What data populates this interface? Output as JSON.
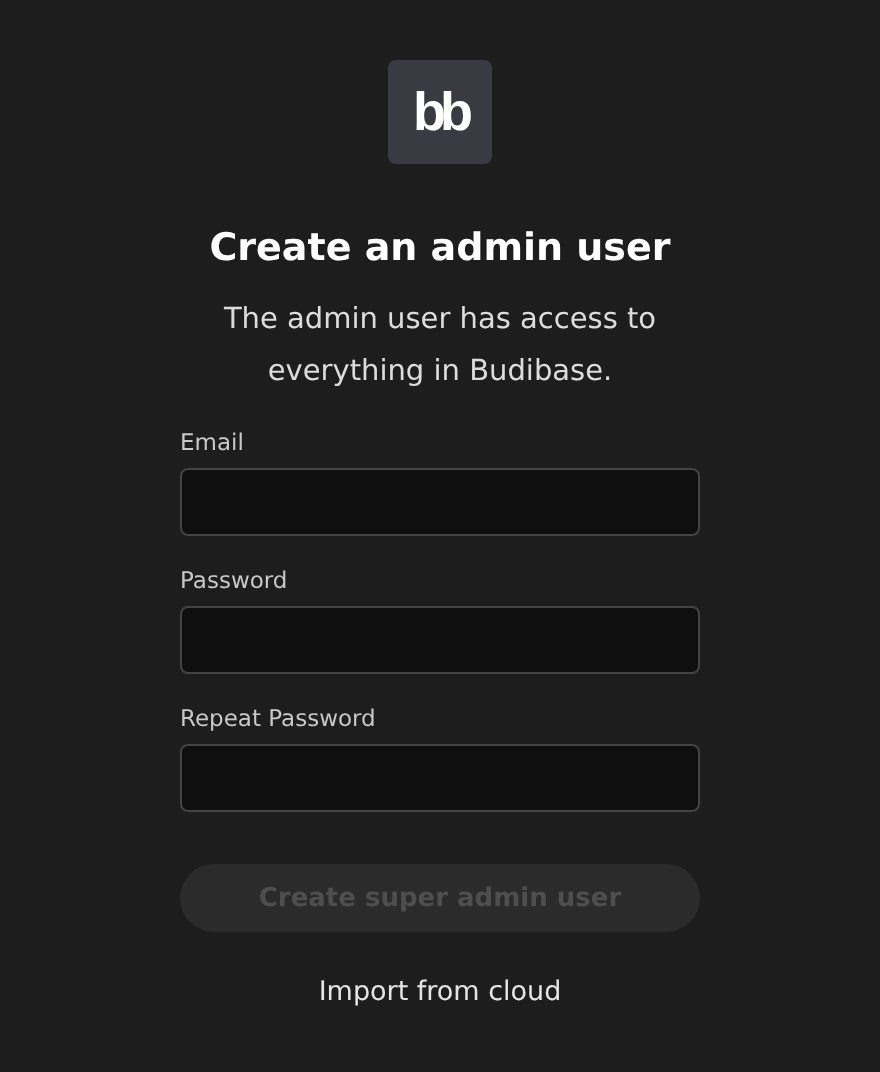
{
  "logo": {
    "text": "bb"
  },
  "title": "Create an admin user",
  "subtitle": "The admin user has access to everything in Budibase.",
  "fields": [
    {
      "label": "Email"
    },
    {
      "label": "Password"
    },
    {
      "label": "Repeat Password"
    }
  ],
  "submit": {
    "label": "Create super admin user",
    "disabled": true
  },
  "link": "Import from cloud"
}
